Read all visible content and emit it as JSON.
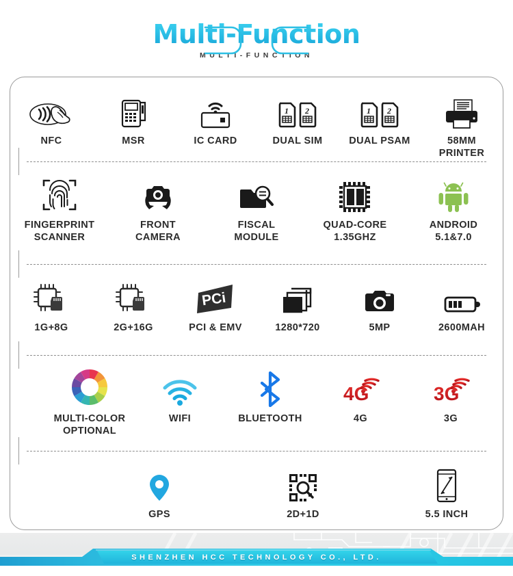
{
  "header": {
    "title": "Multi-Function",
    "subtitle": "MULTI-FUNCTION",
    "title_gradient_top": "#3ed2f0",
    "title_gradient_bottom": "#16a3d6"
  },
  "card": {
    "border_color": "#9a9a9a",
    "divider_style": "dashed"
  },
  "rows": [
    {
      "id": "row1",
      "items": [
        {
          "icon": "nfc-icon",
          "label": "NFC"
        },
        {
          "icon": "pos-terminal-icon",
          "label": "MSR"
        },
        {
          "icon": "contactless-card-icon",
          "label": "IC CARD"
        },
        {
          "icon": "dual-sim-icon",
          "label": "DUAL SIM"
        },
        {
          "icon": "dual-psam-icon",
          "label": "DUAL PSAM"
        },
        {
          "icon": "printer-icon",
          "label": "58MM\nPRINTER"
        }
      ]
    },
    {
      "id": "row2",
      "items": [
        {
          "icon": "fingerprint-icon",
          "label": "FINGERPRINT\nSCANNER"
        },
        {
          "icon": "front-camera-icon",
          "label": "FRONT\nCAMERA"
        },
        {
          "icon": "fiscal-module-icon",
          "label": "FISCAL\nMODULE"
        },
        {
          "icon": "cpu-chip-icon",
          "label": "QUAD-CORE\n1.35GHZ"
        },
        {
          "icon": "android-icon",
          "label": "ANDROID\n5.1&7.0"
        }
      ]
    },
    {
      "id": "row3",
      "items": [
        {
          "icon": "memory-chip-icon",
          "label": "1G+8G"
        },
        {
          "icon": "memory-chip-icon",
          "label": "2G+16G"
        },
        {
          "icon": "pci-logo-icon",
          "label": "PCI & EMV"
        },
        {
          "icon": "resolution-icon",
          "label": "1280*720"
        },
        {
          "icon": "camera-icon",
          "label": "5MP"
        },
        {
          "icon": "battery-icon",
          "label": "2600MAH"
        }
      ]
    },
    {
      "id": "row4",
      "items": [
        {
          "icon": "color-wheel-icon",
          "label": "MULTI-COLOR\nOPTIONAL"
        },
        {
          "icon": "wifi-icon",
          "label": "WIFI"
        },
        {
          "icon": "bluetooth-icon",
          "label": "BLUETOOTH"
        },
        {
          "icon": "4g-signal-icon",
          "label": "4G"
        },
        {
          "icon": "3g-signal-icon",
          "label": "3G"
        }
      ]
    },
    {
      "id": "row5",
      "items": [
        {
          "icon": "gps-pin-icon",
          "label": "GPS"
        },
        {
          "icon": "barcode-scan-icon",
          "label": "2D+1D"
        },
        {
          "icon": "phone-screen-icon",
          "label": "5.5 INCH"
        }
      ]
    }
  ],
  "icon_text": {
    "sim_one": "1",
    "sim_two": "2",
    "pci_logo": "PCi",
    "fourg": "4G",
    "threeg": "3G"
  },
  "footer": {
    "company": "SHENZHEN HCC TECHNOLOGY CO., LTD.",
    "banner_color_left": "#1f9ed1",
    "banner_color_right": "#25c9e4"
  }
}
